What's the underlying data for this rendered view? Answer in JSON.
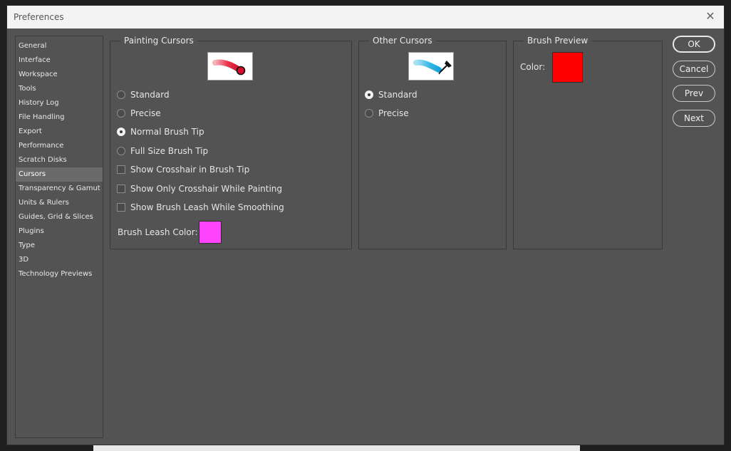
{
  "window": {
    "title": "Preferences",
    "close_glyph": "✕"
  },
  "sidebar": {
    "items": [
      {
        "label": "General"
      },
      {
        "label": "Interface"
      },
      {
        "label": "Workspace"
      },
      {
        "label": "Tools"
      },
      {
        "label": "History Log"
      },
      {
        "label": "File Handling"
      },
      {
        "label": "Export"
      },
      {
        "label": "Performance"
      },
      {
        "label": "Scratch Disks"
      },
      {
        "label": "Cursors",
        "selected": true
      },
      {
        "label": "Transparency & Gamut"
      },
      {
        "label": "Units & Rulers"
      },
      {
        "label": "Guides, Grid & Slices"
      },
      {
        "label": "Plugins"
      },
      {
        "label": "Type"
      },
      {
        "label": "3D"
      },
      {
        "label": "Technology Previews"
      }
    ]
  },
  "painting_cursors": {
    "legend": "Painting Cursors",
    "preview_icon": "brush-stroke-circle-icon",
    "radios": [
      {
        "label": "Standard",
        "selected": false
      },
      {
        "label": "Precise",
        "selected": false
      },
      {
        "label": "Normal Brush Tip",
        "selected": true
      },
      {
        "label": "Full Size Brush Tip",
        "selected": false
      }
    ],
    "checkboxes": [
      {
        "label": "Show Crosshair in Brush Tip",
        "checked": false
      },
      {
        "label": "Show Only Crosshair While Painting",
        "checked": false
      },
      {
        "label": "Show Brush Leash While Smoothing",
        "checked": false
      }
    ],
    "leash_color_label": "Brush Leash Color:",
    "leash_color": "#ff44ff"
  },
  "other_cursors": {
    "legend": "Other Cursors",
    "preview_icon": "eyedropper-stroke-icon",
    "radios": [
      {
        "label": "Standard",
        "selected": true
      },
      {
        "label": "Precise",
        "selected": false
      }
    ]
  },
  "brush_preview": {
    "legend": "Brush Preview",
    "color_label": "Color:",
    "color": "#ff0000"
  },
  "buttons": {
    "ok": "OK",
    "cancel": "Cancel",
    "prev": "Prev",
    "next": "Next"
  },
  "colors": {
    "dialog_bg": "#535353",
    "title_bar": "#f3f3f3",
    "selected_item": "#6a6a6a"
  }
}
